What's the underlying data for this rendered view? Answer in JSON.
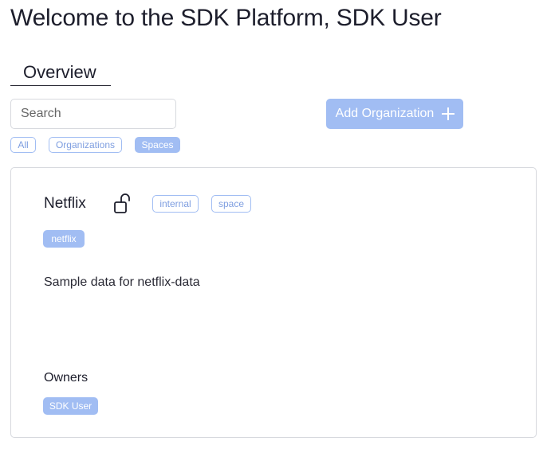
{
  "header": {
    "title": "Welcome to the SDK Platform, SDK User"
  },
  "tabs": [
    {
      "label": "Overview",
      "active": true
    }
  ],
  "search": {
    "placeholder": "Search",
    "value": ""
  },
  "add_organization": {
    "label": "Add Organization",
    "icon": "plus-icon"
  },
  "filters": [
    {
      "label": "All",
      "selected": false
    },
    {
      "label": "Organizations",
      "selected": false
    },
    {
      "label": "Spaces",
      "selected": true
    }
  ],
  "card": {
    "name": "Netflix",
    "lock_icon": "unlock-icon",
    "badges": [
      "internal",
      "space"
    ],
    "tag": "netflix",
    "description": "Sample data for netflix-data",
    "owners_label": "Owners",
    "owners": [
      "SDK User"
    ]
  },
  "colors": {
    "accent": "#a1bdf3",
    "accent_text": "#7e9ee0",
    "border": "#d7d9de",
    "text": "#1d1e2c"
  }
}
